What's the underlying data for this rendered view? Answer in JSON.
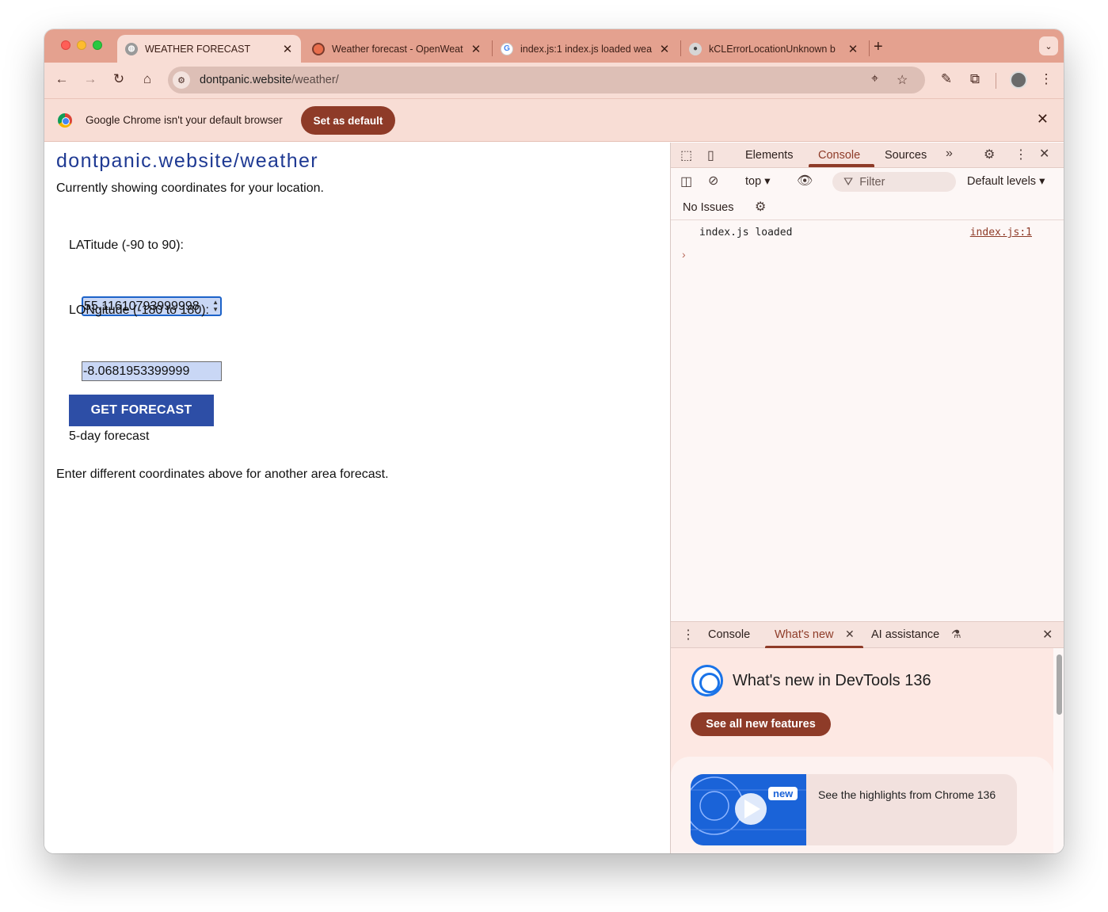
{
  "browser": {
    "tabs": [
      {
        "title": "WEATHER FORECAST",
        "active": true,
        "favicon": "globe-icon"
      },
      {
        "title": "Weather forecast - OpenWeat",
        "active": false,
        "favicon": "openweather-icon"
      },
      {
        "title": "index.js:1 index.js loaded wea",
        "active": false,
        "favicon": "google-icon"
      },
      {
        "title": "kCLErrorLocationUnknown b",
        "active": false,
        "favicon": "apple-icon"
      }
    ],
    "new_tab_symbol": "+",
    "url_domain": "dontpanic.website",
    "url_path": "/weather/",
    "infobar_text": "Google Chrome isn't your default browser",
    "infobar_button": "Set as default",
    "accent_color": "#8e3b28"
  },
  "page": {
    "site_title": "dontpanic.website/weather",
    "subtitle": "Currently showing coordinates for your location.",
    "lat_label": "LATitude (-90 to 90):",
    "lat_value": "55.11610793999998",
    "lon_label": "LONgitude (-180 to 180):",
    "lon_value": "-8.0681953399999",
    "button_label": "GET FORECAST",
    "forecast_caption": "5-day forecast",
    "footer_note": "Enter different coordinates above for another area forecast.",
    "button_color": "#2d4ea6",
    "title_color": "#1f3a93"
  },
  "devtools": {
    "tabs": [
      "Elements",
      "Console",
      "Sources"
    ],
    "active_tab": "Console",
    "context": "top",
    "filter_placeholder": "Filter",
    "levels": "Default levels",
    "issues": "No Issues",
    "console_message": "index.js loaded",
    "console_source": "index.js:1",
    "drawer_tabs": [
      "Console",
      "What's new",
      "AI assistance"
    ],
    "drawer_active": "What's new",
    "whatsnew_title": "What's new in DevTools 136",
    "whatsnew_button": "See all new features",
    "video_badge": "new",
    "video_desc": "See the highlights from Chrome 136"
  }
}
